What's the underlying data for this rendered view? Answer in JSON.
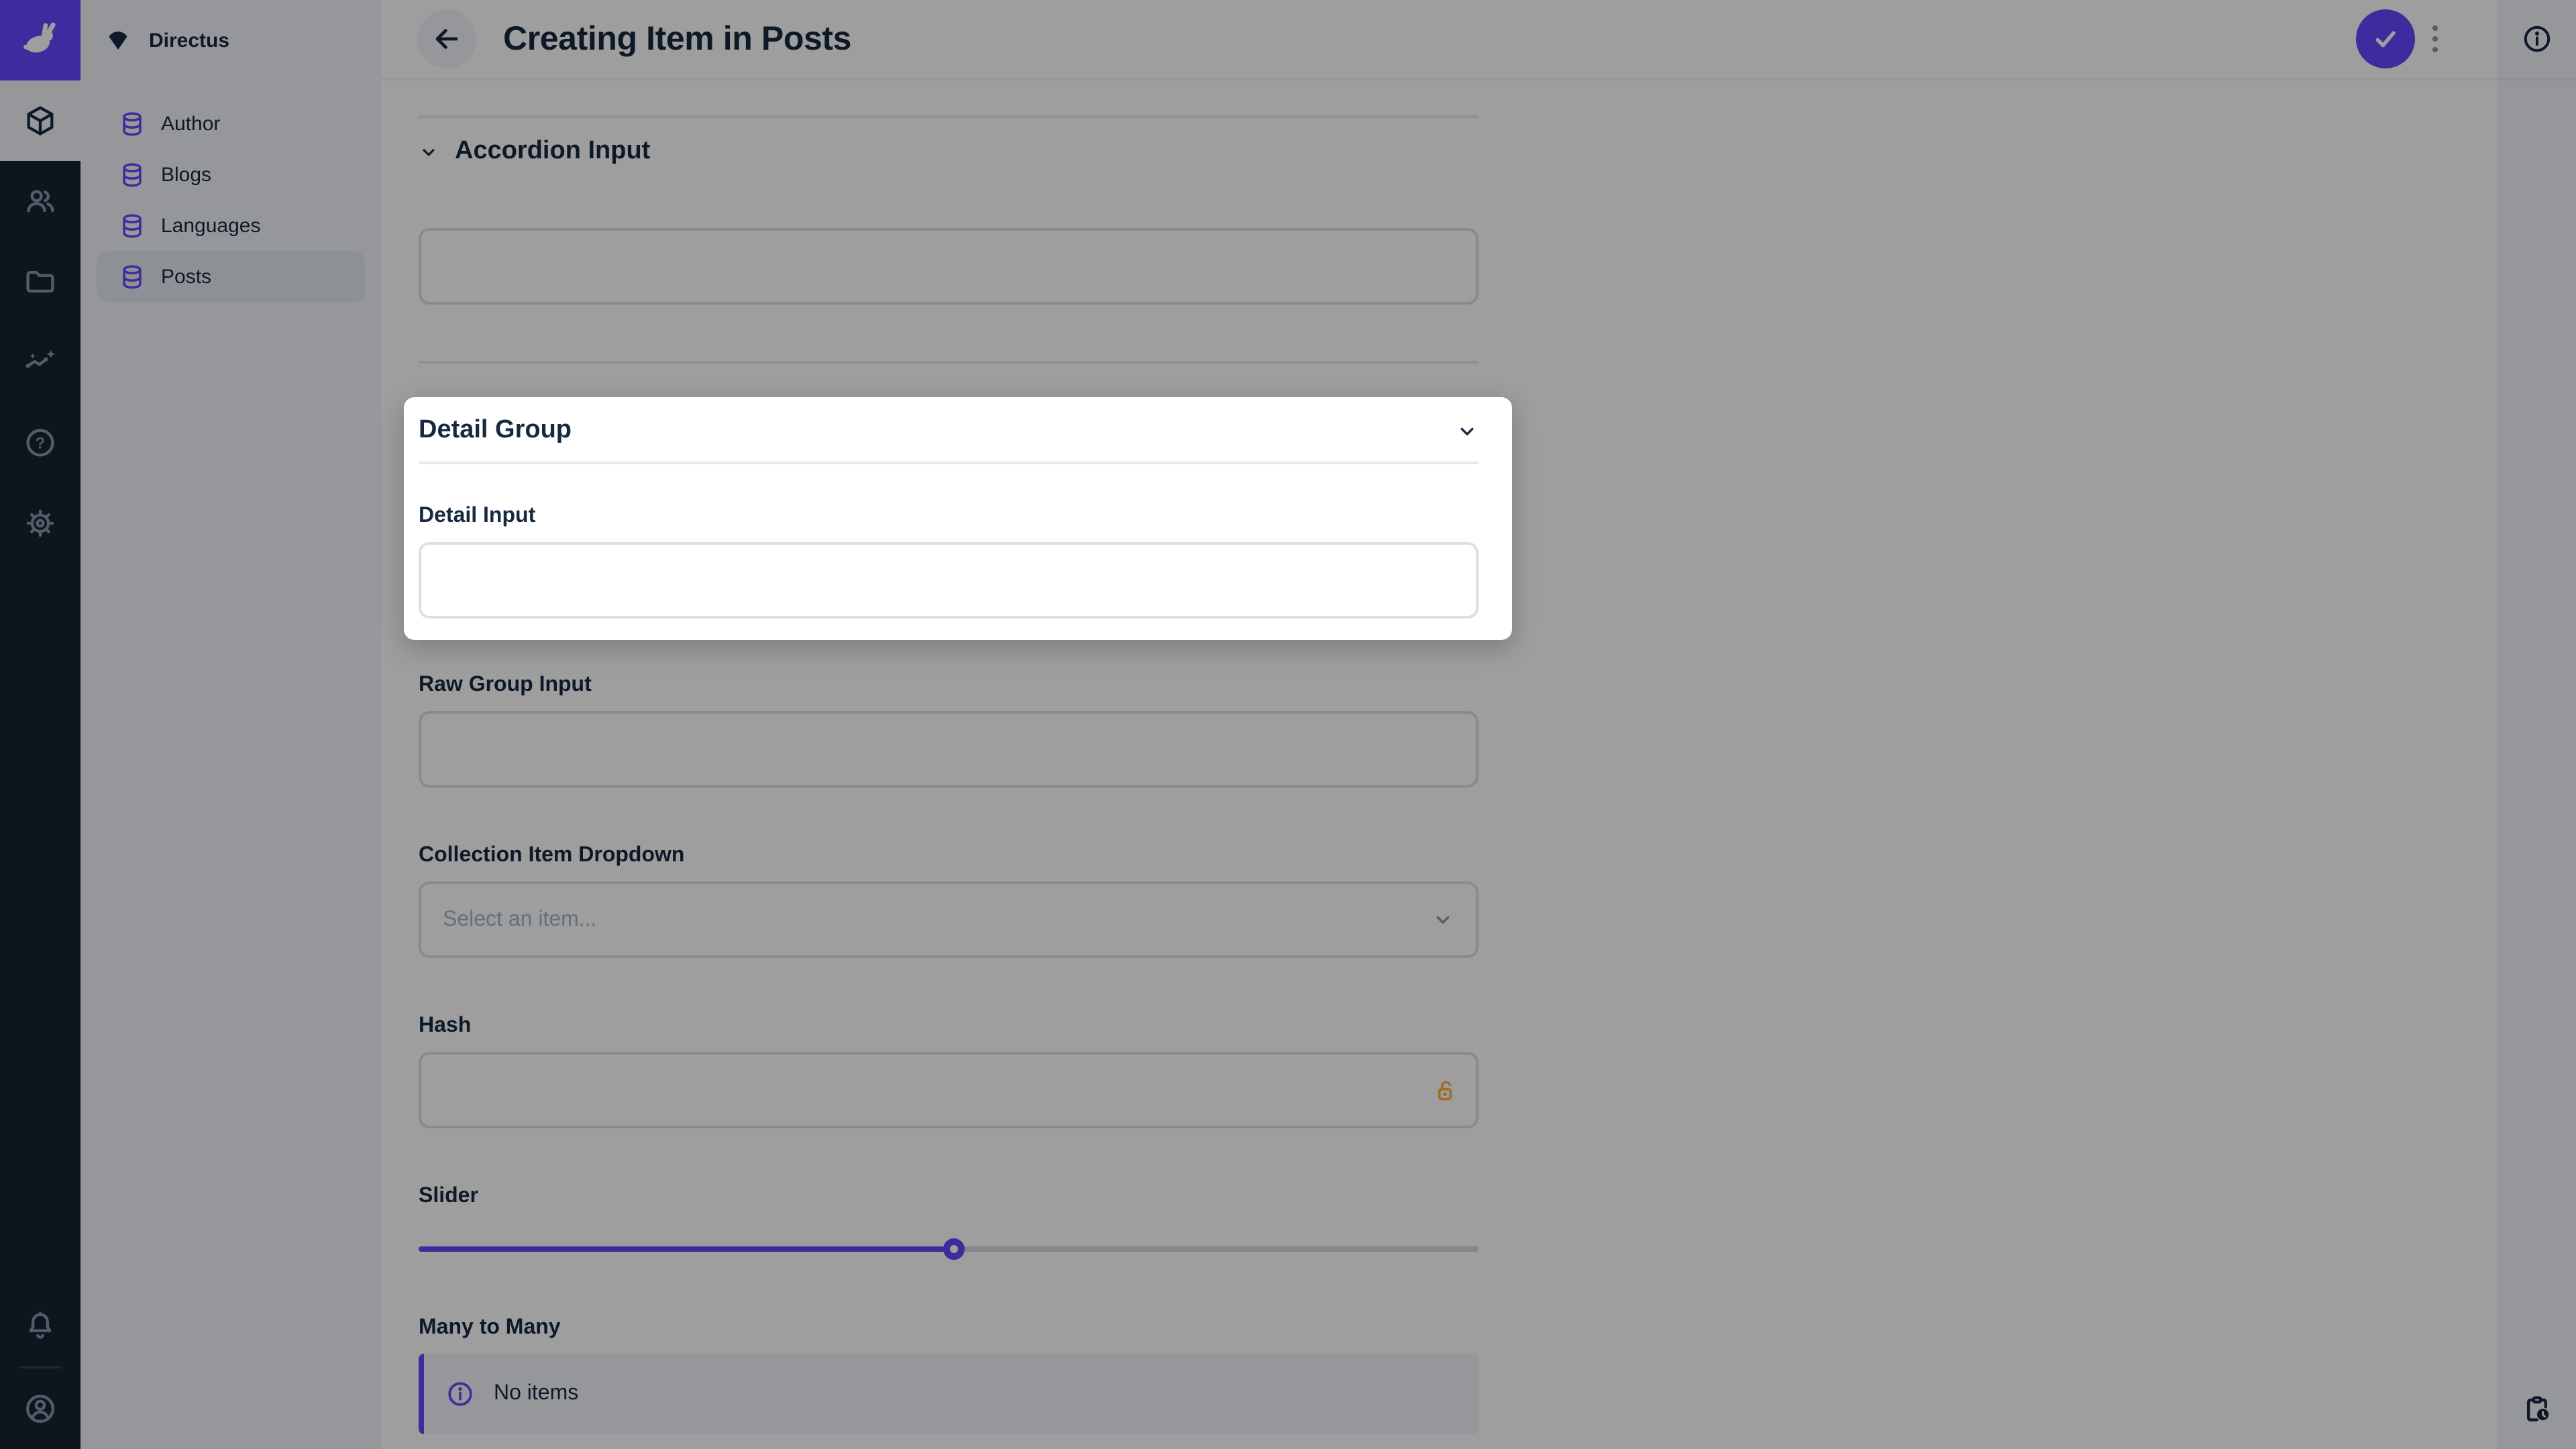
{
  "colors": {
    "accent": "#6644FF",
    "warning": "#FFB444",
    "module_bar_bg": "#18222F",
    "sidebar_bg": "#F0F4F9",
    "heading_text": "#172940",
    "muted_icon": "#8196AD",
    "input_border": "#D9E0EA",
    "divider": "#E4EAF1",
    "overlay": "rgba(0,0,0,0.38)"
  },
  "module_bar": {
    "logo_icon": "directus-rabbit-logo",
    "modules": [
      {
        "icon": "content-module-icon",
        "active": true
      },
      {
        "icon": "user-directory-icon",
        "active": false
      },
      {
        "icon": "file-library-icon",
        "active": false
      },
      {
        "icon": "insights-icon",
        "active": false
      },
      {
        "icon": "help-icon",
        "active": false
      },
      {
        "icon": "settings-icon",
        "active": false
      }
    ],
    "notifications_icon": "bell-icon",
    "account_icon": "avatar-icon"
  },
  "nav": {
    "project_name": "Directus",
    "items": [
      {
        "label": "Author",
        "active": false
      },
      {
        "label": "Blogs",
        "active": false
      },
      {
        "label": "Languages",
        "active": false
      },
      {
        "label": "Posts",
        "active": true
      }
    ]
  },
  "header": {
    "title": "Creating Item in Posts",
    "back_icon": "arrow-left-icon",
    "save_icon": "check-icon",
    "more_icon": "dots-vertical-icon",
    "info_icon": "info-icon",
    "revisions_icon": "clipboard-clock-icon"
  },
  "form": {
    "accordion": {
      "label": "Accordion Input",
      "value": ""
    },
    "detail_group": {
      "title": "Detail Group",
      "input_label": "Detail Input",
      "input_value": ""
    },
    "raw_group_input": {
      "label": "Raw Group Input",
      "value": ""
    },
    "collection_item_dropdown": {
      "label": "Collection Item Dropdown",
      "placeholder": "Select an item..."
    },
    "hash": {
      "label": "Hash",
      "value": ""
    },
    "slider": {
      "label": "Slider",
      "percent": 50.5
    },
    "many_to_many": {
      "label": "Many to Many",
      "notice": "No items"
    }
  }
}
